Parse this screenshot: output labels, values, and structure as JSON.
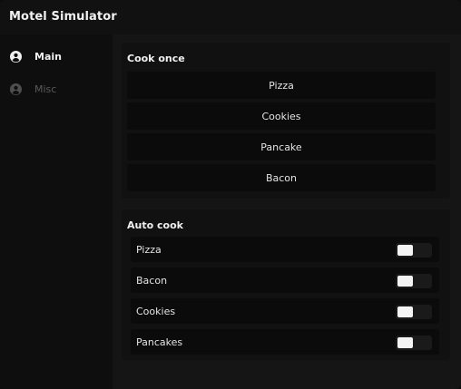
{
  "window": {
    "title": "Motel Simulator"
  },
  "sidebar": {
    "items": [
      {
        "label": "Main",
        "icon": "user-circle-icon",
        "active": true
      },
      {
        "label": "Misc",
        "icon": "user-circle-icon",
        "active": false
      }
    ]
  },
  "cook_once": {
    "title": "Cook once",
    "buttons": [
      "Pizza",
      "Cookies",
      "Pancake",
      "Bacon"
    ]
  },
  "auto_cook": {
    "title": "Auto cook",
    "toggles": [
      {
        "label": "Pizza",
        "on": false
      },
      {
        "label": "Bacon",
        "on": false
      },
      {
        "label": "Cookies",
        "on": false
      },
      {
        "label": "Pancakes",
        "on": false
      }
    ]
  },
  "colors": {
    "window_bg": "#0f0f0f",
    "panel_bg": "#151515",
    "section_bg": "#111111",
    "button_bg": "#0b0b0b",
    "text_primary": "#f0f0f0",
    "text_muted": "#5a5a5a"
  }
}
